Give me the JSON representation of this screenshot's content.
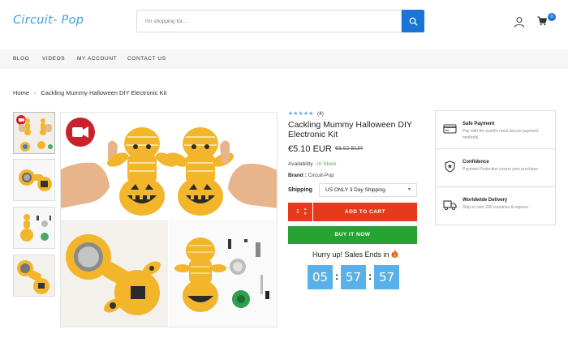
{
  "header": {
    "logo": "Circuit- Pop",
    "search_placeholder": "I'm shopping for...",
    "cart_count": "0"
  },
  "nav": {
    "items": [
      "BLOG",
      "VIDEOS",
      "MY ACCOUNT",
      "CONTACT US"
    ]
  },
  "breadcrumb": {
    "home": "Home",
    "current": "Cackling Mummy Halloween DIY Electronic Kit"
  },
  "product": {
    "stars": "★★★★★",
    "review_count": "(4)",
    "title": "Cackling Mummy Halloween DIY Electronic Kit",
    "price": "€5.10 EUR",
    "old_price": "€8.52 EUR",
    "availability_label": "Availability : ",
    "availability_value": "In Stock",
    "brand_label": "Brand : ",
    "brand_value": "Circuit-Pop",
    "shipping_label": "Shipping",
    "shipping_value": "US ONLY 3 Day Shipping",
    "qty": "1",
    "add_to_cart": "ADD TO CART",
    "buy_now": "BUY IT NOW",
    "hurry_text": "Hurry up! Sales Ends in",
    "timer": [
      "05",
      "57",
      "57"
    ]
  },
  "features": [
    {
      "icon": "credit-card-icon",
      "title": "Safe Payment",
      "desc": "Pay with the world's most secure payment methods."
    },
    {
      "icon": "shield-icon",
      "title": "Confidence",
      "desc": "Payment Protection covers your purchase."
    },
    {
      "icon": "truck-icon",
      "title": "Worldwide Delivery",
      "desc": "Ship to over 200 countries & regions."
    }
  ],
  "colors": {
    "accent": "#1a73d6",
    "logo": "#3da1d8",
    "add_to_cart": "#e53a1c",
    "buy_now": "#27a334",
    "timer": "#5ab0e8",
    "in_stock": "#4caf50",
    "video_badge": "#c8232c"
  }
}
